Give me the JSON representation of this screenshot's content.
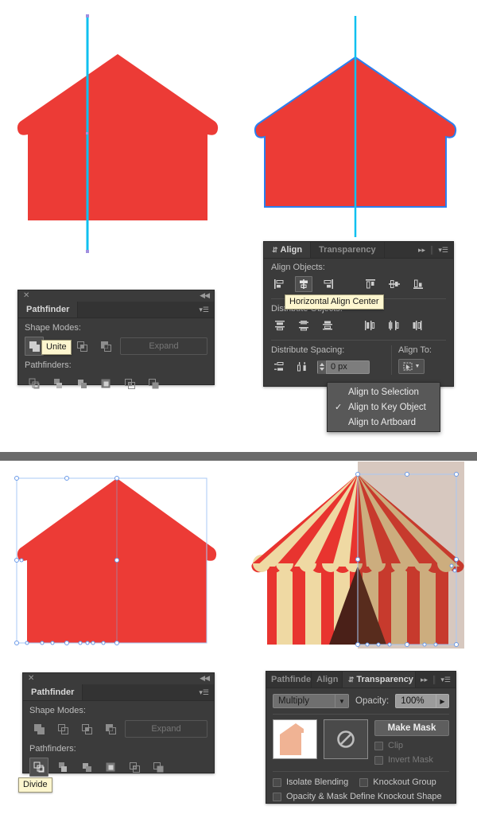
{
  "meta": {
    "app": "Adobe Illustrator",
    "canvas_bg": "#ffffff",
    "divider_color": "#6b6b6b"
  },
  "artwork": {
    "house_red": "#ec3b36",
    "guide_cyan": "#0fc0f0",
    "selection_blue": "#2b7fef",
    "selection_blue_light": "#a8c8f5",
    "tent": {
      "stripe_red": "#e8342f",
      "stripe_cream": "#efd9a3",
      "shade_red": "#d32b26",
      "shade_cream": "#d9ae7c",
      "door_dark": "#4a2018",
      "door_shade": "#3b1812"
    },
    "thumbnail_house": "#f0b394"
  },
  "pathfinder_panel_top": {
    "close_icon": "close-icon",
    "collapse_icon": "collapse-icon",
    "tabs": [
      {
        "label": "Pathfinder",
        "active": true
      }
    ],
    "menu_icon": "panel-menu-icon",
    "shape_modes_label": "Shape Modes:",
    "pathfinders_label": "Pathfinders:",
    "expand_label": "Expand",
    "shape_mode_buttons": [
      {
        "name": "unite",
        "selected": true
      },
      {
        "name": "minus-front",
        "selected": false
      },
      {
        "name": "intersect",
        "selected": false
      },
      {
        "name": "exclude",
        "selected": false
      }
    ],
    "pathfinder_buttons": [
      {
        "name": "divide",
        "selected": false
      },
      {
        "name": "trim",
        "selected": false
      },
      {
        "name": "merge",
        "selected": false
      },
      {
        "name": "crop",
        "selected": false
      },
      {
        "name": "outline",
        "selected": false
      },
      {
        "name": "minus-back",
        "selected": false
      }
    ],
    "tooltip": "Unite"
  },
  "align_panel": {
    "tabs": [
      {
        "label": "Align",
        "active": true
      },
      {
        "label": "Transparency",
        "active": false
      }
    ],
    "collapse_icon": "double-chevron-right-icon",
    "menu_icon": "panel-menu-icon",
    "align_objects_label": "Align Objects:",
    "distribute_objects_label": "Distribute Objects:",
    "distribute_spacing_label": "Distribute Spacing:",
    "align_to_label": "Align To:",
    "spacing_value": "0 px",
    "tooltip": "Horizontal Align Center",
    "align_objects_buttons": [
      {
        "name": "horizontal-align-left",
        "selected": false
      },
      {
        "name": "horizontal-align-center",
        "selected": true
      },
      {
        "name": "horizontal-align-right",
        "selected": false
      },
      {
        "name": "vertical-align-top",
        "selected": false
      },
      {
        "name": "vertical-align-center",
        "selected": false
      },
      {
        "name": "vertical-align-bottom",
        "selected": false
      }
    ],
    "distribute_objects_buttons": [
      {
        "name": "vertical-distribute-top",
        "selected": false
      },
      {
        "name": "vertical-distribute-center",
        "selected": false
      },
      {
        "name": "vertical-distribute-bottom",
        "selected": false
      },
      {
        "name": "horizontal-distribute-left",
        "selected": false
      },
      {
        "name": "horizontal-distribute-center",
        "selected": false
      },
      {
        "name": "horizontal-distribute-right",
        "selected": false
      }
    ],
    "dropdown": {
      "items": [
        {
          "label": "Align to Selection",
          "checked": false
        },
        {
          "label": "Align to Key Object",
          "checked": true
        },
        {
          "label": "Align to Artboard",
          "checked": false
        }
      ]
    }
  },
  "pathfinder_panel_bottom": {
    "close_icon": "close-icon",
    "collapse_icon": "collapse-icon",
    "tabs": [
      {
        "label": "Pathfinder",
        "active": true
      }
    ],
    "menu_icon": "panel-menu-icon",
    "shape_modes_label": "Shape Modes:",
    "pathfinders_label": "Pathfinders:",
    "expand_label": "Expand",
    "tooltip": "Divide"
  },
  "transparency_panel": {
    "tabs": [
      {
        "label": "Pathfinde",
        "active": false
      },
      {
        "label": "Align",
        "active": false
      },
      {
        "label": "Transparency",
        "active": true
      }
    ],
    "collapse_icon": "double-chevron-right-icon",
    "menu_icon": "panel-menu-icon",
    "blend_mode": "Multiply",
    "opacity_label": "Opacity:",
    "opacity_value": "100%",
    "make_mask_label": "Make Mask",
    "clip_label": "Clip",
    "invert_mask_label": "Invert Mask",
    "isolate_blending_label": "Isolate Blending",
    "knockout_group_label": "Knockout Group",
    "knockout_shape_label": "Opacity & Mask Define Knockout Shape",
    "mask_empty_icon": "no-mask-icon",
    "checkboxes": {
      "clip": false,
      "invert_mask": false,
      "isolate_blending": false,
      "knockout_group": false,
      "knockout_shape": false
    }
  }
}
